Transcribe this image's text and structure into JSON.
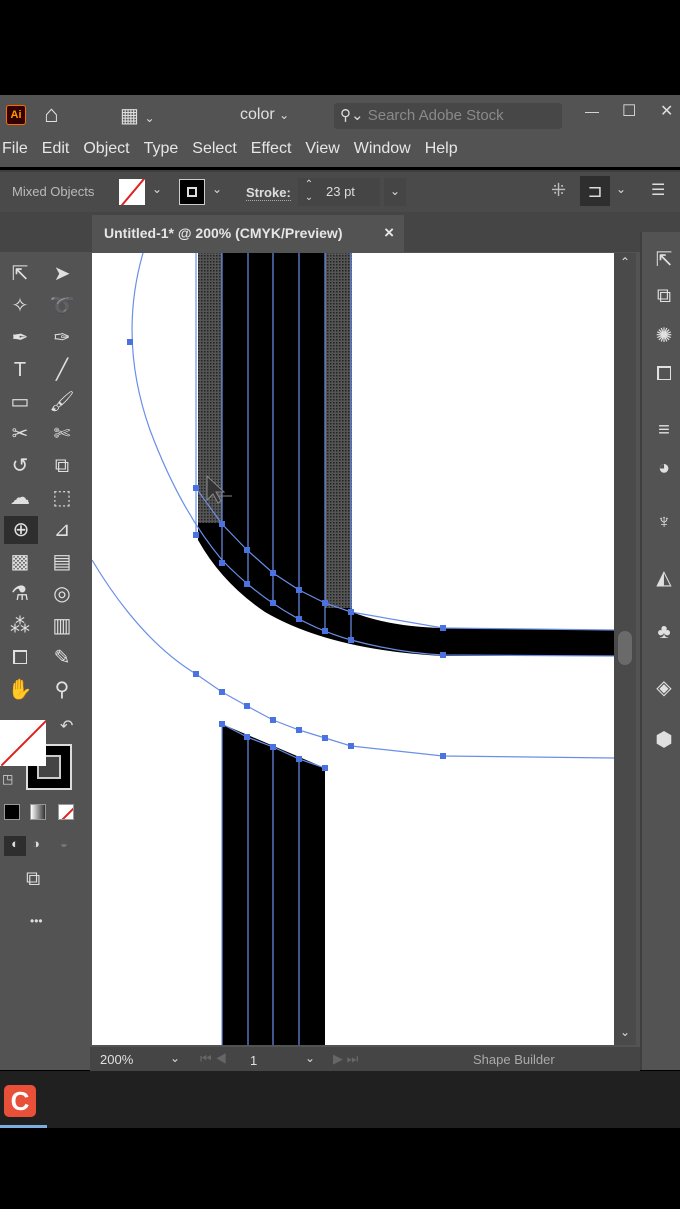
{
  "appbar": {
    "logo": "Ai",
    "workspace": "color",
    "search_placeholder": "Search Adobe Stock",
    "min": "—",
    "max": "☐",
    "close": "✕"
  },
  "menu": [
    "File",
    "Edit",
    "Object",
    "Type",
    "Select",
    "Effect",
    "View",
    "Window",
    "Help"
  ],
  "control": {
    "selection": "Mixed Objects",
    "stroke_label": "Stroke:",
    "stroke_value": "23 pt"
  },
  "tab": {
    "title": "Untitled-1* @ 200% (CMYK/Preview)",
    "close": "×"
  },
  "status": {
    "zoom": "200%",
    "page": "1",
    "tool": "Shape Builder"
  },
  "more_tools": "•••"
}
